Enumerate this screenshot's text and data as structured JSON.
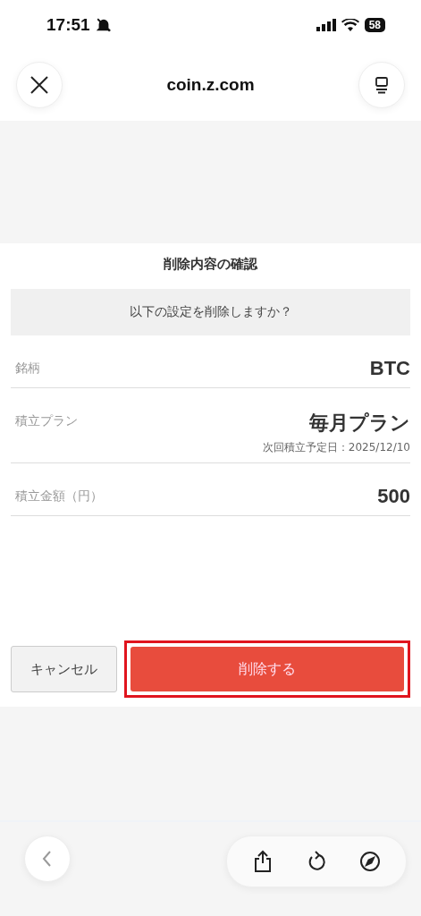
{
  "status_bar": {
    "time": "17:51",
    "silent": true,
    "battery": "58"
  },
  "browser": {
    "url": "coin.z.com"
  },
  "dialog": {
    "title": "削除内容の確認",
    "question": "以下の設定を削除しますか？",
    "rows": [
      {
        "label": "銘柄",
        "value": "BTC"
      },
      {
        "label": "積立プラン",
        "value": "毎月プラン",
        "note": "次回積立予定日：2025/12/10"
      },
      {
        "label": "積立金額（円）",
        "value": "500"
      }
    ],
    "cancel": "キャンセル",
    "confirm": {
      "label": "削除する",
      "highlighted": true
    }
  }
}
